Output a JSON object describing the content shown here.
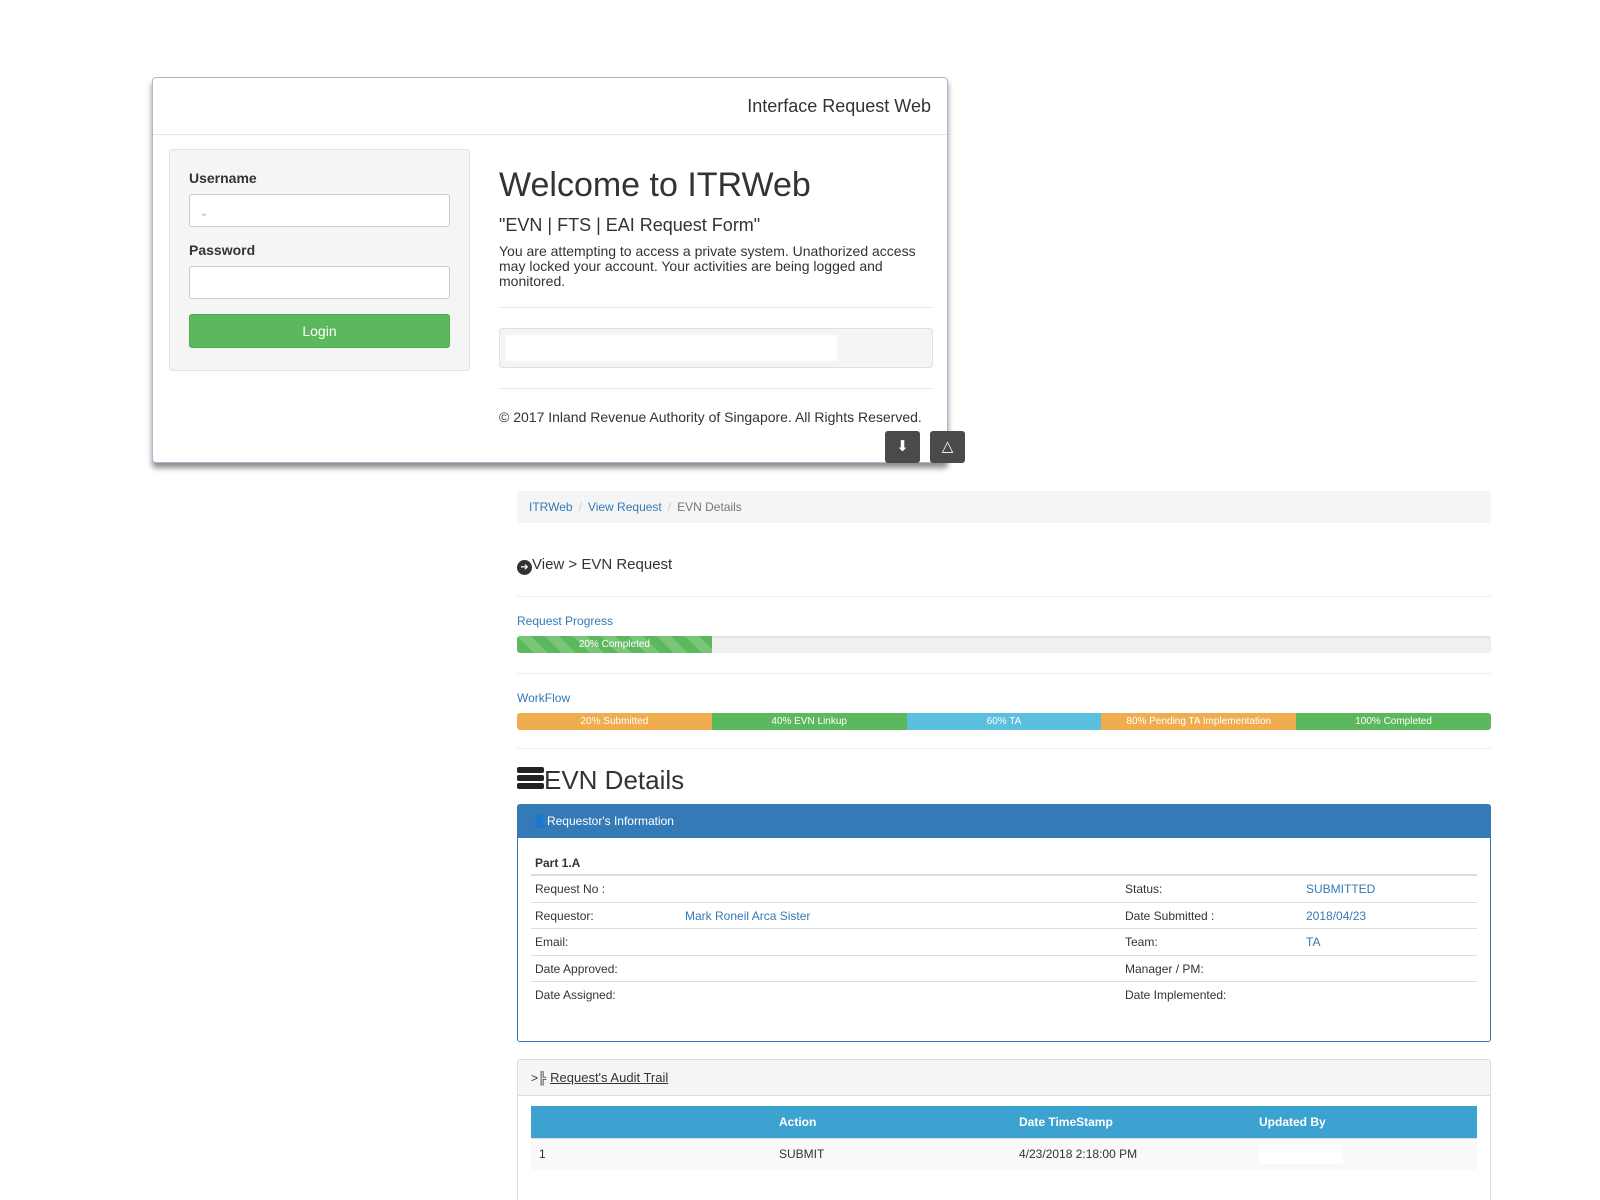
{
  "login": {
    "header_title": "Interface Request Web",
    "username_label": "Username",
    "username_value": "ˬ",
    "password_label": "Password",
    "password_value": "",
    "login_button": "Login",
    "welcome_title": "Welcome to ITRWeb",
    "subtitle": "\"EVN | FTS | EAI Request Form\"",
    "warning": "You are attempting to access a private system. Unathorized access may locked your account. Your activities are being logged and monitored.",
    "copyright": "© 2017 Inland Revenue Authority of Singapore. All Rights Reserved.",
    "icons": [
      "download-icon",
      "drive-add-icon"
    ]
  },
  "breadcrumb": [
    "ITRWeb",
    "View Request",
    "EVN Details"
  ],
  "view_title": "View > EVN Request",
  "request_progress": {
    "label": "Request Progress",
    "percent": 20,
    "text": "20% Completed"
  },
  "workflow": {
    "label": "WorkFlow",
    "steps": [
      {
        "label": "20% Submitted",
        "color": "#f0ad4e"
      },
      {
        "label": "40% EVN Linkup",
        "color": "#5cb85c"
      },
      {
        "label": "60% TA",
        "color": "#5bc0de"
      },
      {
        "label": "80% Pending TA Implementation",
        "color": "#f0ad4e"
      },
      {
        "label": "100% Completed",
        "color": "#5cb85c"
      }
    ]
  },
  "details_title": "EVN Details",
  "requestor_panel": {
    "title": "Requestor's Information",
    "part": "Part 1.A",
    "rows": [
      {
        "k1": "Request No :",
        "v1": "",
        "k2": "Status:",
        "v2": "SUBMITTED"
      },
      {
        "k1": "Requestor:",
        "v1": "Mark Roneil Arca Sister",
        "k2": "Date Submitted :",
        "v2": "2018/04/23"
      },
      {
        "k1": "Email:",
        "v1": "",
        "k2": "Team:",
        "v2": "TA"
      },
      {
        "k1": "Date Approved:",
        "v1": "",
        "k2": "Manager / PM:",
        "v2": ""
      },
      {
        "k1": "Date Assigned:",
        "v1": "",
        "k2": "Date Implemented:",
        "v2": ""
      }
    ]
  },
  "audit_trail": {
    "title": "Request's Audit Trail",
    "columns": [
      "",
      "Action",
      "Date TimeStamp",
      "Updated By"
    ],
    "rows": [
      {
        "no": "1",
        "action": "SUBMIT",
        "timestamp": "4/23/2018 2:18:00 PM",
        "updated_by": ""
      }
    ]
  },
  "colors": {
    "primary": "#337ab7",
    "success": "#5cb85c",
    "warning": "#f0ad4e",
    "info": "#5bc0de"
  }
}
